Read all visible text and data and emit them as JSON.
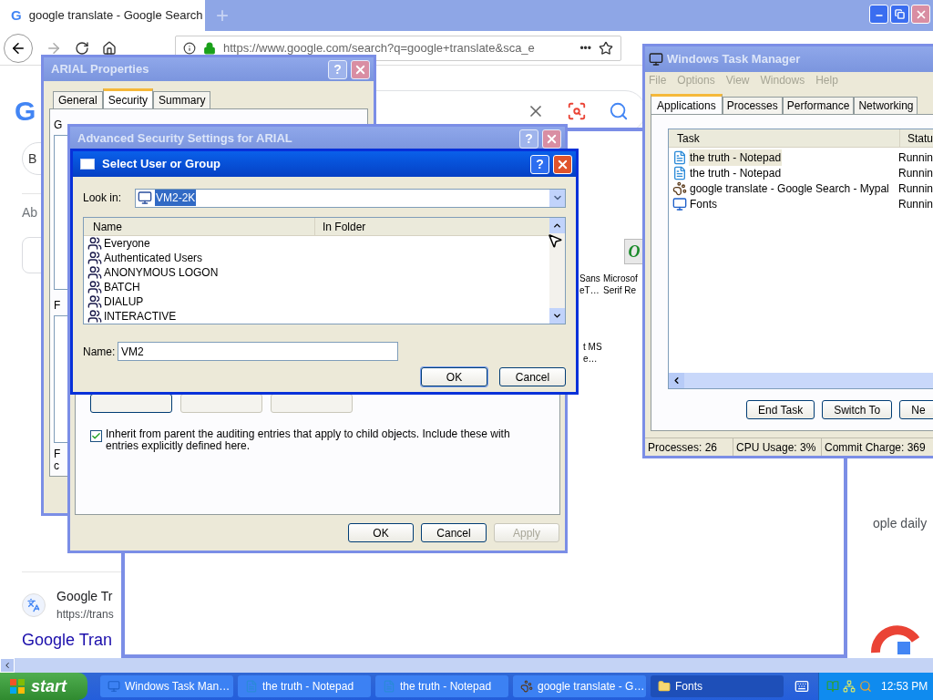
{
  "browser": {
    "favicon": "G",
    "tab_title": "google translate - Google Search",
    "new_tab": "+",
    "url": "https://www.google.com/search?q=google+translate&sca_e",
    "more": "•••"
  },
  "page": {
    "logo": "G",
    "chip": "B",
    "about": "Ab",
    "snippet": "ople daily",
    "result": {
      "site": "Google Tr",
      "url": "https://trans",
      "title": "Google Tran"
    }
  },
  "fonts_window": {
    "icon_letter": "O",
    "items": [
      {
        "line1": "Sans",
        "line2": "eT…"
      },
      {
        "line1": "Microsof",
        "line2": "Serif Re"
      },
      {
        "line1": "t MS",
        "line2": "e…"
      }
    ]
  },
  "properties": {
    "title": "ARIAL Properties",
    "active": false,
    "help": "?",
    "tabs": [
      {
        "label": "General",
        "selected": false
      },
      {
        "label": "Security",
        "selected": true
      },
      {
        "label": "Summary",
        "selected": false
      }
    ],
    "section_label": "G",
    "list_label": "F",
    "note_lines": [
      "F",
      "c"
    ]
  },
  "advanced": {
    "title": "Advanced Security Settings for ARIAL",
    "active": false,
    "help": "?",
    "hidden_buttons": [
      {
        "disabled": false
      },
      {
        "disabled": true
      },
      {
        "disabled": true
      }
    ],
    "inherit": {
      "checked": true,
      "label": "Inherit from parent the auditing entries that apply to child objects. Include these with entries explicitly defined here."
    },
    "buttons": [
      {
        "label": "OK",
        "disabled": false
      },
      {
        "label": "Cancel",
        "disabled": false
      },
      {
        "label": "Apply",
        "disabled": true
      }
    ]
  },
  "select_dialog": {
    "title": "Select User or Group",
    "active": true,
    "help": "?",
    "look_in": {
      "label": "Look in:",
      "value": "VM2-2K",
      "highlighted": true
    },
    "columns": [
      "Name",
      "In Folder"
    ],
    "rows": [
      "Everyone",
      "Authenticated Users",
      "ANONYMOUS LOGON",
      "BATCH",
      "DIALUP",
      "INTERACTIVE"
    ],
    "name_field": {
      "label": "Name:",
      "value": "VM2"
    },
    "buttons": [
      {
        "label": "OK",
        "default": true
      },
      {
        "label": "Cancel",
        "default": false
      }
    ]
  },
  "task_manager": {
    "title": "Windows Task Manager",
    "active": false,
    "menu": [
      "File",
      "Options",
      "View",
      "Windows",
      "Help"
    ],
    "tabs": [
      {
        "label": "Applications",
        "selected": true
      },
      {
        "label": "Processes",
        "selected": false
      },
      {
        "label": "Performance",
        "selected": false
      },
      {
        "label": "Networking",
        "selected": false
      }
    ],
    "columns": [
      "Task",
      "Statu"
    ],
    "rows": [
      {
        "task": "the truth - Notepad",
        "status": "Runnin",
        "kind": "notepad",
        "selected": true
      },
      {
        "task": "the truth - Notepad",
        "status": "Runnin",
        "kind": "notepad",
        "selected": false
      },
      {
        "task": "google translate - Google Search - Mypal",
        "status": "Runnin",
        "kind": "browser",
        "selected": false
      },
      {
        "task": "Fonts",
        "status": "Runnin",
        "kind": "monitor",
        "selected": false
      }
    ],
    "buttons": [
      "End Task",
      "Switch To",
      "Ne"
    ],
    "status": [
      "Processes: 26",
      "CPU Usage: 3%",
      "Commit Charge: 369"
    ]
  },
  "taskbar": {
    "start": "start",
    "items": [
      {
        "label": "Windows Task Man…",
        "kind": "monitor",
        "selected": false
      },
      {
        "label": "the truth - Notepad",
        "kind": "notepad",
        "selected": false
      },
      {
        "label": "the truth - Notepad",
        "kind": "notepad",
        "selected": false
      },
      {
        "label": "google translate - G…",
        "kind": "browser",
        "selected": false
      },
      {
        "label": "Fonts",
        "kind": "folder",
        "selected": true
      }
    ],
    "time": "12:53 PM"
  }
}
